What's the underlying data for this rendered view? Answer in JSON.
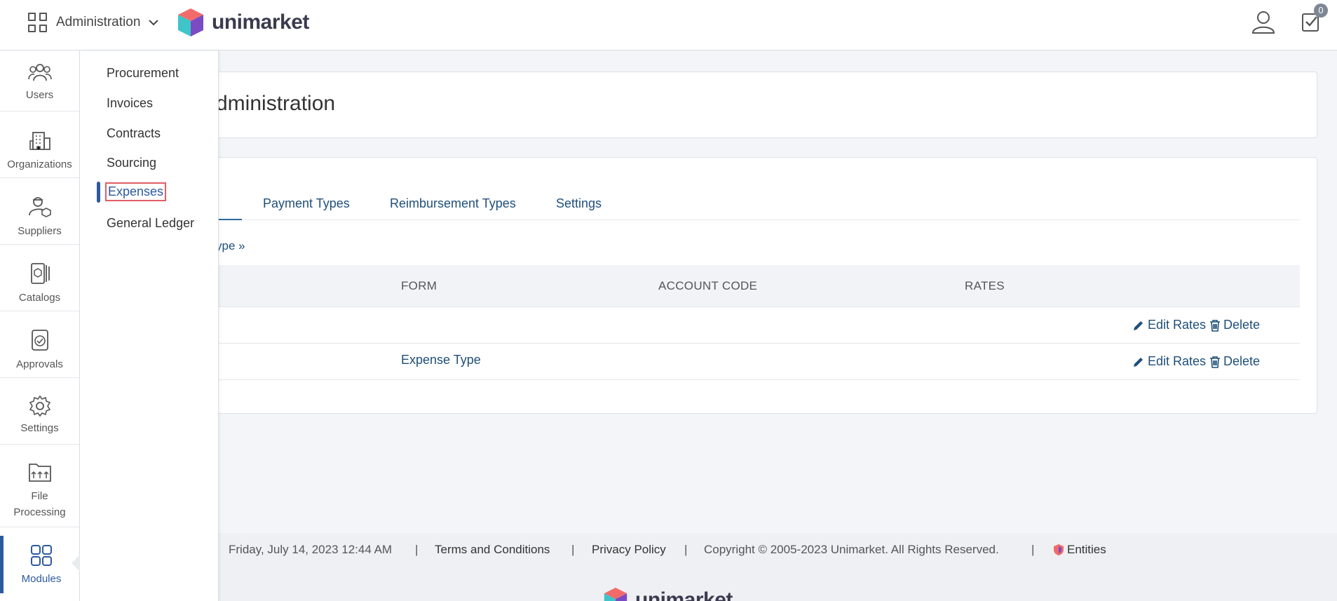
{
  "header": {
    "app_switch_label": "Administration",
    "logo_text": "unimarket",
    "task_badge": "0"
  },
  "rail": {
    "items": [
      {
        "label": "Users",
        "icon": "users-icon"
      },
      {
        "label": "Organizations",
        "icon": "building-icon"
      },
      {
        "label": "Suppliers",
        "icon": "supplier-icon"
      },
      {
        "label": "Catalogs",
        "icon": "catalog-icon"
      },
      {
        "label": "Approvals",
        "icon": "approval-icon"
      },
      {
        "label": "Settings",
        "icon": "gear-icon"
      },
      {
        "label_line1": "File",
        "label_line2": "Processing",
        "icon": "file-processing-icon"
      },
      {
        "label": "Modules",
        "icon": "modules-icon",
        "active": true
      }
    ]
  },
  "flyout": {
    "items": [
      "Procurement",
      "Invoices",
      "Contracts",
      "Sourcing",
      "Expenses",
      "General Ledger"
    ],
    "active": "Expenses"
  },
  "main": {
    "title_visible": "dministration",
    "tabs": [
      "s",
      "Payment Types",
      "Reimbursement Types",
      "Settings"
    ],
    "add_link": "ype »",
    "columns": [
      "FORM",
      "ACCOUNT CODE",
      "RATES"
    ],
    "rows": [
      {
        "form": "",
        "account_code": "",
        "rates": ""
      },
      {
        "form": "Expense Type",
        "account_code": "",
        "rates": ""
      }
    ],
    "edit_label": "Edit Rates",
    "delete_label": "Delete"
  },
  "footer": {
    "datetime": "Friday, July 14, 2023 12:44 AM",
    "sep": "|",
    "terms": "Terms and Conditions",
    "privacy": "Privacy Policy",
    "copyright": "Copyright © 2005-2023 Unimarket. All Rights Reserved.",
    "entities": "Entities",
    "logo_text": "unimarket"
  },
  "colors": {
    "accent": "#2c5aa0",
    "link": "#1f4f7a",
    "highlight": "#e15d66"
  }
}
